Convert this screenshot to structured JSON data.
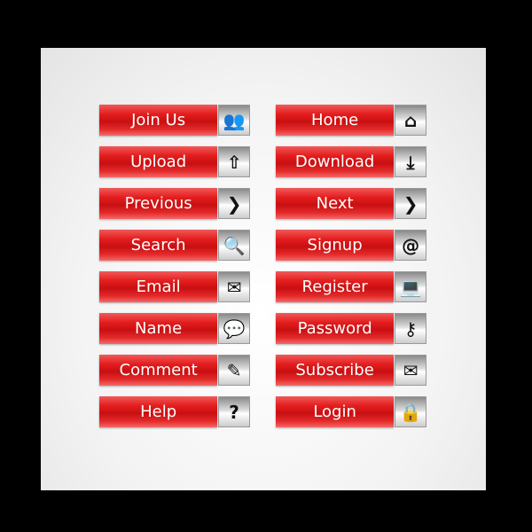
{
  "buttons": [
    {
      "label": "Join Us",
      "icon": "users-icon",
      "glyph": "👥"
    },
    {
      "label": "Home",
      "icon": "home-icon",
      "glyph": "⌂"
    },
    {
      "label": "Upload",
      "icon": "upload-icon",
      "glyph": "⇧"
    },
    {
      "label": "Download",
      "icon": "download-icon",
      "glyph": "⤓"
    },
    {
      "label": "Previous",
      "icon": "chevron-icon",
      "glyph": "❯"
    },
    {
      "label": "Next",
      "icon": "chevron-icon",
      "glyph": "❯"
    },
    {
      "label": "Search",
      "icon": "search-document-icon",
      "glyph": "🔍"
    },
    {
      "label": "Signup",
      "icon": "at-icon",
      "glyph": "@"
    },
    {
      "label": "Email",
      "icon": "envelope-icon",
      "glyph": "✉"
    },
    {
      "label": "Register",
      "icon": "laptop-icon",
      "glyph": "💻"
    },
    {
      "label": "Name",
      "icon": "speech-bubble-icon",
      "glyph": "💬"
    },
    {
      "label": "Password",
      "icon": "key-icon",
      "glyph": "⚷"
    },
    {
      "label": "Comment",
      "icon": "document-pen-icon",
      "glyph": "✎"
    },
    {
      "label": "Subscribe",
      "icon": "envelope-cursor-icon",
      "glyph": "✉"
    },
    {
      "label": "Help",
      "icon": "question-icon",
      "glyph": "?"
    },
    {
      "label": "Login",
      "icon": "lock-icon",
      "glyph": "🔒"
    }
  ],
  "colors": {
    "button_red": "#e41e1e",
    "background": "#000000"
  }
}
